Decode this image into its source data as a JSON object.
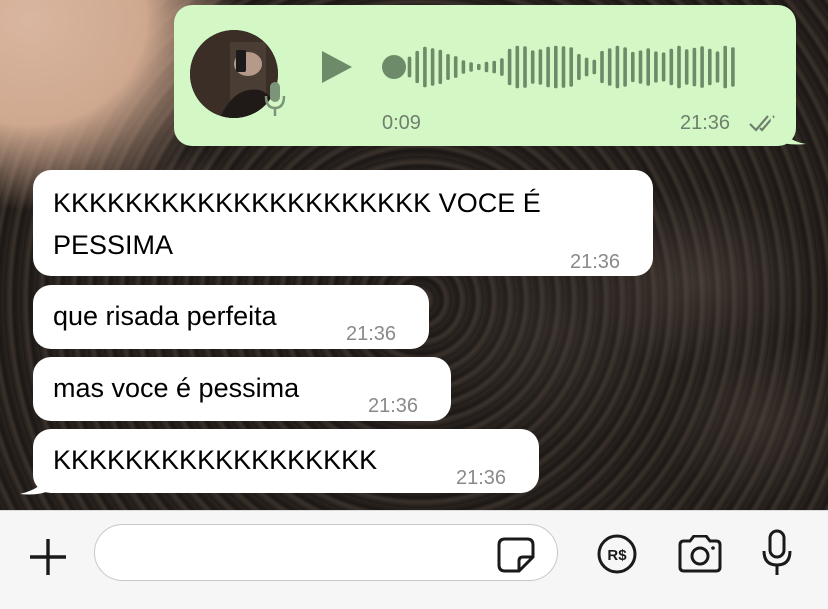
{
  "voice_message": {
    "duration": "0:09",
    "time": "21:36",
    "status": "read",
    "waveform": [
      0.28,
      0.4,
      0.62,
      0.78,
      0.72,
      0.66,
      0.5,
      0.42,
      0.26,
      0.18,
      0.12,
      0.2,
      0.24,
      0.34,
      0.7,
      0.82,
      0.8,
      0.64,
      0.68,
      0.78,
      0.82,
      0.8,
      0.76,
      0.5,
      0.36,
      0.28,
      0.62,
      0.72,
      0.82,
      0.76,
      0.58,
      0.64,
      0.72,
      0.6,
      0.56,
      0.7,
      0.82,
      0.68,
      0.74,
      0.8,
      0.7,
      0.6,
      0.82,
      0.76
    ]
  },
  "messages": [
    {
      "text_line1": "KKKKKKKKKKKKKKKKKKKKK VOCE É",
      "text_line2": "PESSIMA",
      "time": "21:36"
    },
    {
      "text": "que risada perfeita",
      "time": "21:36"
    },
    {
      "text": "mas voce é pessima",
      "time": "21:36"
    },
    {
      "text": "KKKKKKKKKKKKKKKKKK",
      "time": "21:36"
    }
  ],
  "input_bar": {
    "placeholder": "",
    "value": ""
  },
  "colors": {
    "outgoing_bubble": "#d3f8c6",
    "incoming_bubble": "#ffffff",
    "input_bar_bg": "#f6f6f6"
  },
  "icons": [
    "plus-icon",
    "sticker-icon",
    "payment-icon",
    "camera-icon",
    "microphone-icon",
    "play-icon",
    "read-receipt-icon"
  ]
}
